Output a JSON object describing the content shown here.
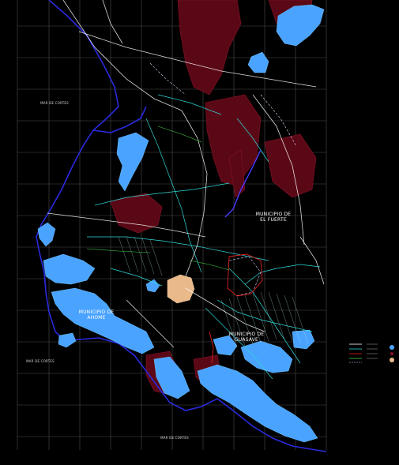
{
  "map": {
    "labels": {
      "municipio_el_fuerte": "MUNICIPIO DE\nEL FUERTE",
      "municipio_ahome": "MUNICIPIO DE\nAHOME",
      "municipio_guasave": "MUNICIPIO DE\nGUASAVE",
      "west_label": "MAR DE CORTES",
      "southwest_label": "MAR DE CORTES",
      "south_label": "MAR DE CORTES"
    },
    "colors": {
      "background": "#000000",
      "grid": "#5a5a5a",
      "coast": "#2222cc",
      "water": "#4aa3ff",
      "relief": "#6b0a1a",
      "roads": "#ffffff",
      "canals": "#2fd8d8",
      "urban": "#e9b98a"
    },
    "legend": {
      "icon_names": [
        "legend-road-line",
        "legend-canal-line",
        "legend-water-symbol",
        "legend-urban-symbol"
      ]
    }
  }
}
